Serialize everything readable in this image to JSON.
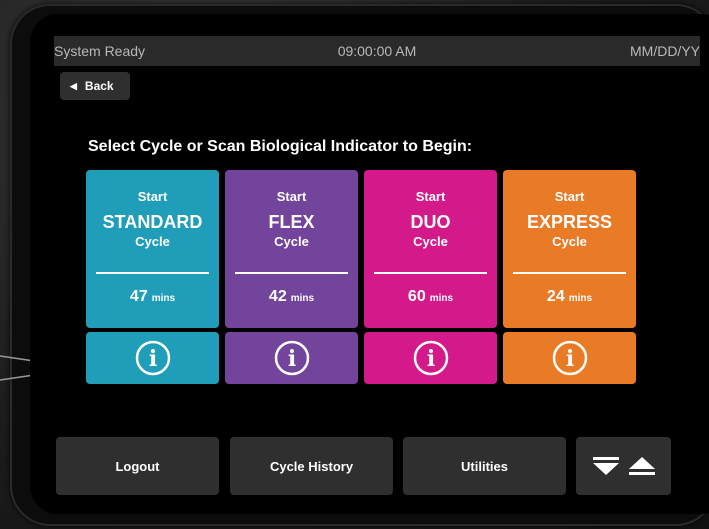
{
  "status": {
    "left": "System Ready",
    "time": "09:00:00 AM",
    "date": "MM/DD/YY"
  },
  "back_label": "Back",
  "prompt": "Select Cycle or Scan Biological Indicator to Begin:",
  "cycles": [
    {
      "start": "Start",
      "name": "STANDARD",
      "cycle": "Cycle",
      "duration": "47",
      "unit": "mins",
      "color": "#1f9db9"
    },
    {
      "start": "Start",
      "name": "FLEX",
      "cycle": "Cycle",
      "duration": "42",
      "unit": "mins",
      "color": "#73449c"
    },
    {
      "start": "Start",
      "name": "DUO",
      "cycle": "Cycle",
      "duration": "60",
      "unit": "mins",
      "color": "#d4198a"
    },
    {
      "start": "Start",
      "name": "EXPRESS",
      "cycle": "Cycle",
      "duration": "24",
      "unit": "mins",
      "color": "#e97a26"
    }
  ],
  "info_icon": "info-circle-icon",
  "bottom": {
    "logout": "Logout",
    "history": "Cycle History",
    "utilities": "Utilities"
  },
  "eject_icons": [
    "triangle-down-icon",
    "eject-icon"
  ]
}
